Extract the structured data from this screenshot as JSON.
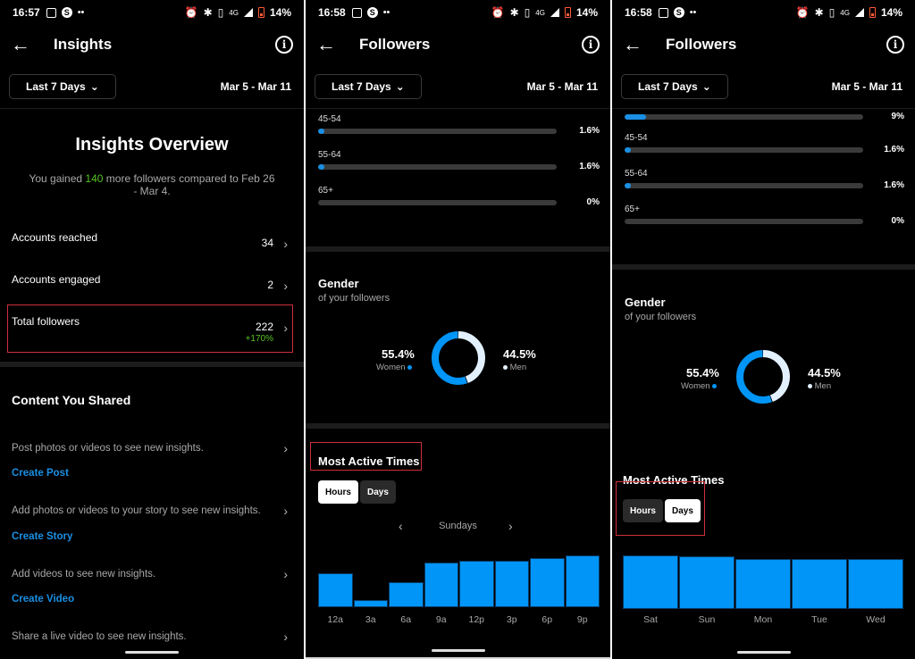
{
  "screens": [
    {
      "status": {
        "time": "16:57",
        "battery": "14%",
        "network": "4G"
      },
      "header": {
        "title": "Insights",
        "range_label": "Last 7 Days",
        "date_range": "Mar 5 - Mar 11"
      },
      "overview": {
        "title": "Insights Overview",
        "subtitle_pre": "You gained ",
        "subtitle_num": "140",
        "subtitle_post": " more followers compared to Feb 26 - Mar 4."
      },
      "metrics": [
        {
          "label": "Accounts reached",
          "value": "34"
        },
        {
          "label": "Accounts engaged",
          "value": "2"
        },
        {
          "label": "Total followers",
          "value": "222",
          "delta": "+170%"
        }
      ],
      "content": {
        "title": "Content You Shared",
        "items": [
          {
            "text": "Post photos or videos to see new insights.",
            "link": "Create Post"
          },
          {
            "text": "Add photos or videos to your story to see new insights.",
            "link": "Create Story"
          },
          {
            "text": "Add videos to see new insights.",
            "link": "Create Video"
          },
          {
            "text": "Share a live video to see new insights."
          }
        ]
      }
    },
    {
      "status": {
        "time": "16:58",
        "battery": "14%",
        "network": "4G"
      },
      "header": {
        "title": "Followers",
        "range_label": "Last 7 Days",
        "date_range": "Mar 5 - Mar 11"
      },
      "age": [
        {
          "label": "45-54",
          "percent": 1.6,
          "text": "1.6%"
        },
        {
          "label": "55-64",
          "percent": 1.6,
          "text": "1.6%"
        },
        {
          "label": "65+",
          "percent": 0,
          "text": "0%"
        }
      ],
      "gender": {
        "title": "Gender",
        "subtitle": "of your followers",
        "women": {
          "value": "55.4%",
          "label": "Women",
          "percent": 55.4
        },
        "men": {
          "value": "44.5%",
          "label": "Men",
          "percent": 44.5
        }
      },
      "active": {
        "title": "Most Active Times",
        "tabs": [
          "Hours",
          "Days"
        ],
        "selected": "Hours",
        "day_label": "Sundays"
      }
    },
    {
      "status": {
        "time": "16:58",
        "battery": "14%",
        "network": "4G"
      },
      "header": {
        "title": "Followers",
        "range_label": "Last 7 Days",
        "date_range": "Mar 5 - Mar 11"
      },
      "age": [
        {
          "label": "",
          "percent": 9,
          "text": "9%"
        },
        {
          "label": "45-54",
          "percent": 1.6,
          "text": "1.6%"
        },
        {
          "label": "55-64",
          "percent": 1.6,
          "text": "1.6%"
        },
        {
          "label": "65+",
          "percent": 0,
          "text": "0%"
        }
      ],
      "gender": {
        "title": "Gender",
        "subtitle": "of your followers",
        "women": {
          "value": "55.4%",
          "label": "Women",
          "percent": 55.4
        },
        "men": {
          "value": "44.5%",
          "label": "Men",
          "percent": 44.5
        }
      },
      "active": {
        "title": "Most Active Times",
        "tabs": [
          "Hours",
          "Days"
        ],
        "selected": "Days"
      }
    }
  ],
  "colors": {
    "accent": "#0095f6",
    "link": "#1a8fe3",
    "positive": "#58c322",
    "highlight_box": "#cf2f3a",
    "men_segment": "#e3f1ff"
  },
  "chart_data": [
    {
      "type": "bar",
      "title": "Most Active Times - Hours (Sundays)",
      "categories": [
        "12a",
        "3a",
        "6a",
        "9a",
        "12p",
        "3p",
        "6p",
        "9p"
      ],
      "values": [
        38,
        8,
        28,
        50,
        52,
        52,
        55,
        58
      ],
      "xlabel": "",
      "ylabel": "",
      "ylim": [
        0,
        60
      ]
    },
    {
      "type": "bar",
      "title": "Most Active Times - Days",
      "categories": [
        "Sat",
        "Sun",
        "Mon",
        "Tue",
        "Wed"
      ],
      "values": [
        58,
        57,
        54,
        54.5,
        54
      ],
      "xlabel": "",
      "ylabel": "",
      "ylim": [
        0,
        60
      ]
    },
    {
      "type": "pie",
      "title": "Gender of your followers",
      "categories": [
        "Women",
        "Men"
      ],
      "values": [
        55.4,
        44.5
      ]
    }
  ]
}
